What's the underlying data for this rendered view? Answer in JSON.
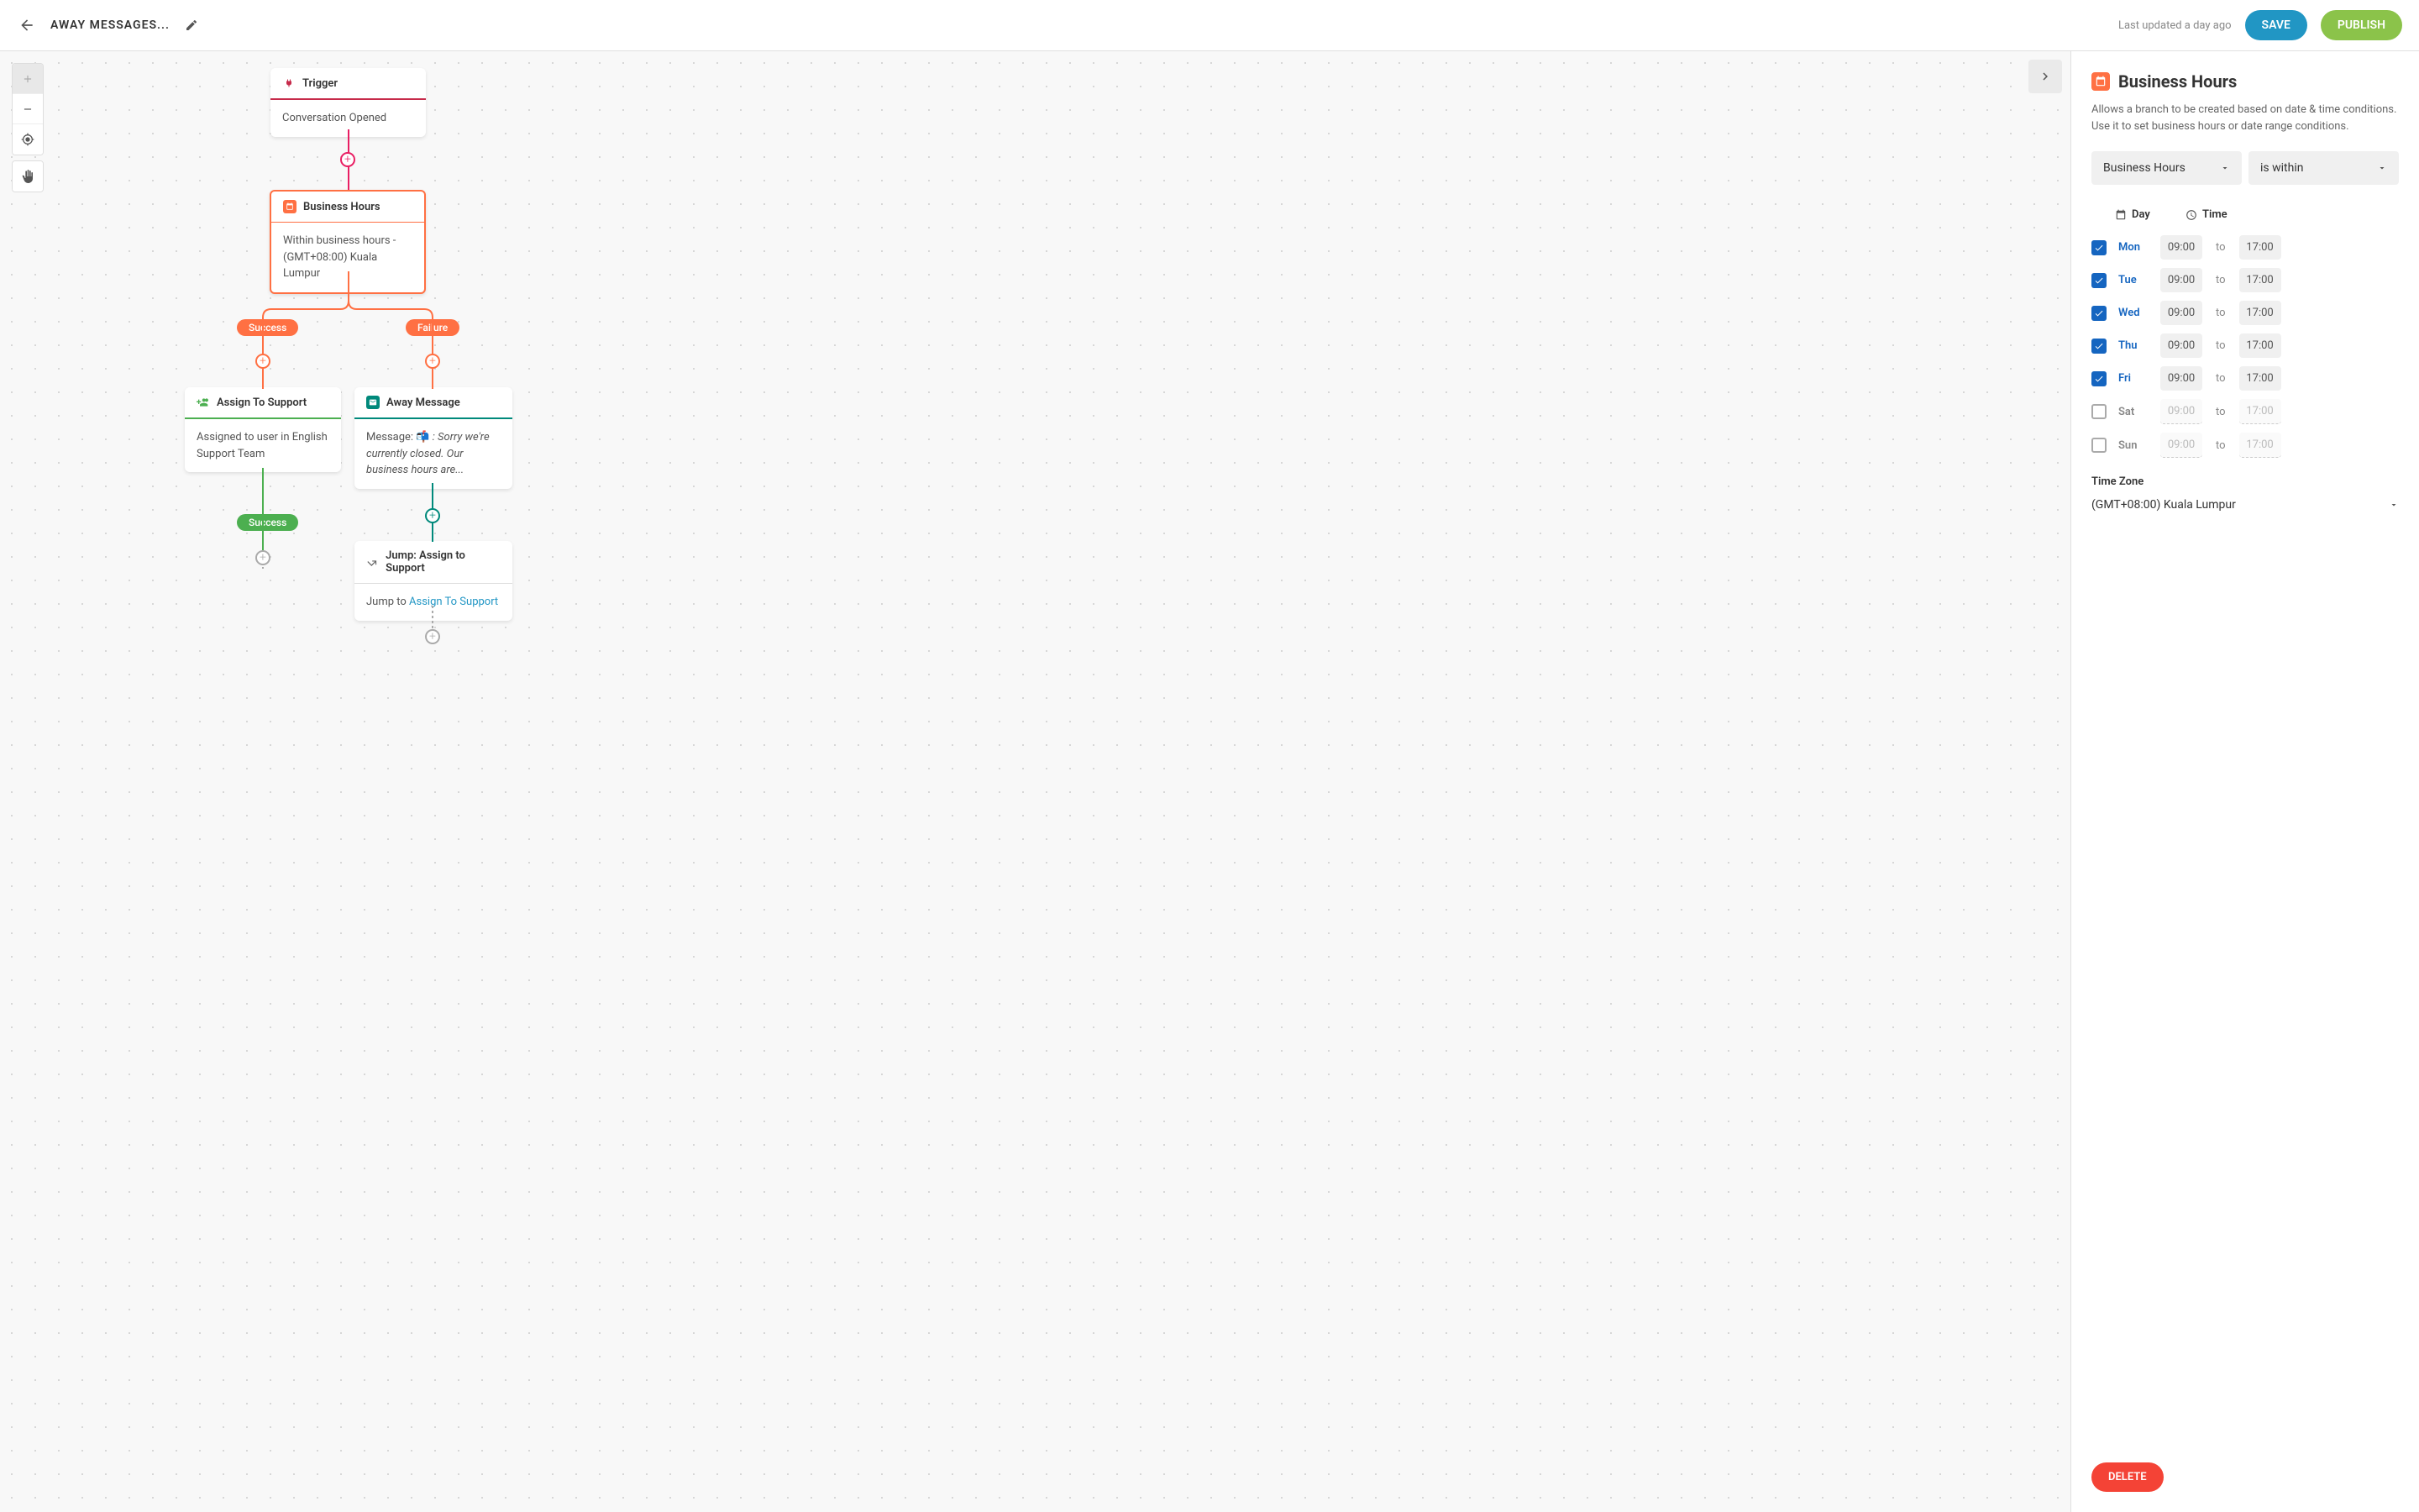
{
  "header": {
    "title": "AWAY MESSAGES...",
    "lastUpdated": "Last updated a day ago",
    "save": "SAVE",
    "publish": "PUBLISH"
  },
  "flow": {
    "trigger": {
      "title": "Trigger",
      "body": "Conversation Opened"
    },
    "businessHours": {
      "title": "Business Hours",
      "body": "Within business hours - (GMT+08:00) Kuala Lumpur"
    },
    "assignSupport": {
      "title": "Assign To Support",
      "body": "Assigned to user in English Support Team"
    },
    "awayMessage": {
      "title": "Away Message",
      "prefix": "Message: 📬 ",
      "text": ": Sorry we're currently closed. Our business hours are..."
    },
    "jump": {
      "title": "Jump: Assign to Support",
      "prefix": "Jump to ",
      "link": "Assign To Support"
    },
    "branches": {
      "success": "Success",
      "failure": "Failure"
    }
  },
  "sidebar": {
    "title": "Business Hours",
    "desc": "Allows a branch to be created based on date & time conditions. Use it to set business hours or date range conditions.",
    "conditionType": "Business Hours",
    "conditionOp": "is within",
    "columns": {
      "day": "Day",
      "time": "Time"
    },
    "days": [
      {
        "label": "Mon",
        "checked": true,
        "start": "09:00",
        "end": "17:00"
      },
      {
        "label": "Tue",
        "checked": true,
        "start": "09:00",
        "end": "17:00"
      },
      {
        "label": "Wed",
        "checked": true,
        "start": "09:00",
        "end": "17:00"
      },
      {
        "label": "Thu",
        "checked": true,
        "start": "09:00",
        "end": "17:00"
      },
      {
        "label": "Fri",
        "checked": true,
        "start": "09:00",
        "end": "17:00"
      },
      {
        "label": "Sat",
        "checked": false,
        "start": "09:00",
        "end": "17:00"
      },
      {
        "label": "Sun",
        "checked": false,
        "start": "09:00",
        "end": "17:00"
      }
    ],
    "to": "to",
    "tzLabel": "Time Zone",
    "tzValue": "(GMT+08:00) Kuala Lumpur",
    "delete": "DELETE"
  }
}
